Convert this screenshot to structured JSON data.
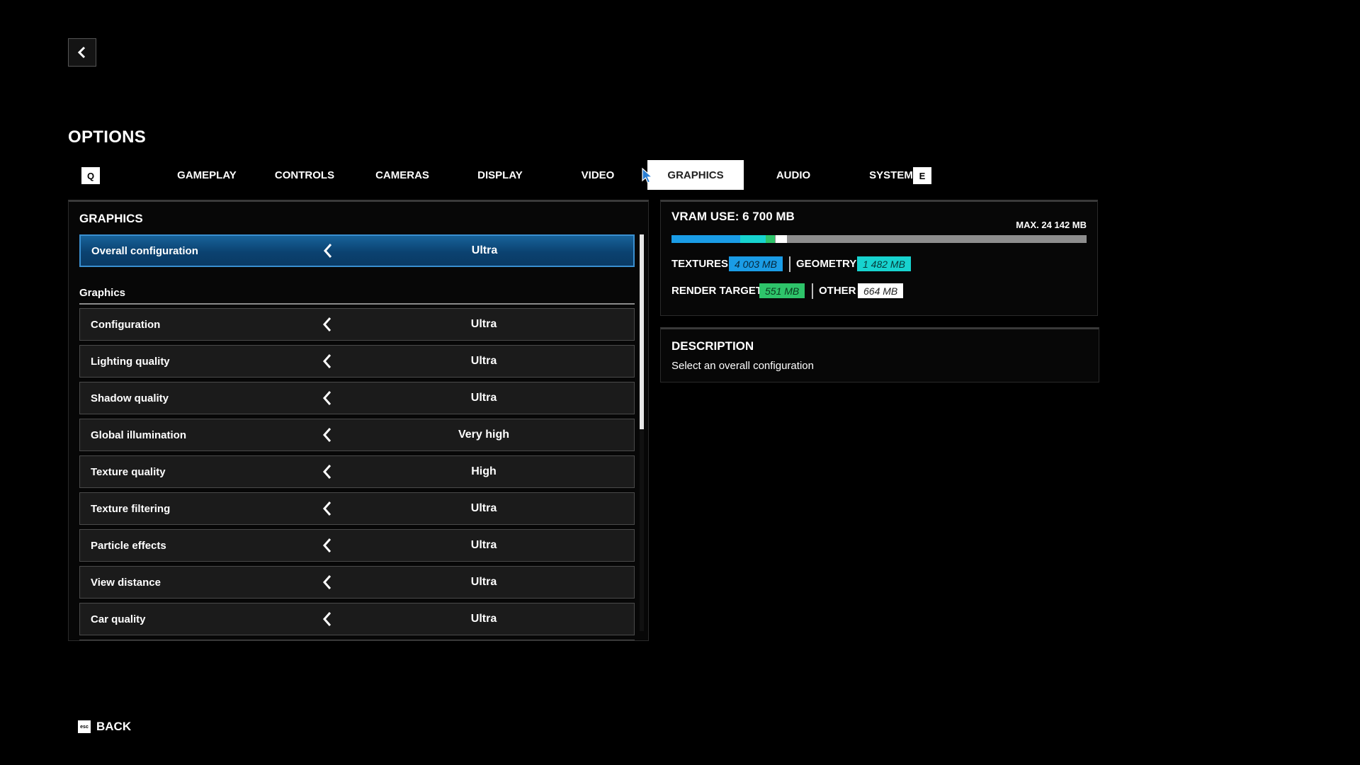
{
  "header": {
    "title": "OPTIONS"
  },
  "tabs": {
    "prev_key": "Q",
    "next_key": "E",
    "items": [
      {
        "label": "GAMEPLAY"
      },
      {
        "label": "CONTROLS"
      },
      {
        "label": "CAMERAS"
      },
      {
        "label": "DISPLAY"
      },
      {
        "label": "VIDEO"
      },
      {
        "label": "GRAPHICS",
        "active": true
      },
      {
        "label": "AUDIO"
      },
      {
        "label": "SYSTEM"
      }
    ]
  },
  "graphics_panel": {
    "title": "GRAPHICS",
    "overall": {
      "label": "Overall configuration",
      "value": "Ultra"
    },
    "section_label": "Graphics",
    "settings": [
      {
        "label": "Configuration",
        "value": "Ultra"
      },
      {
        "label": "Lighting quality",
        "value": "Ultra"
      },
      {
        "label": "Shadow quality",
        "value": "Ultra"
      },
      {
        "label": "Global illumination",
        "value": "Very high"
      },
      {
        "label": "Texture quality",
        "value": "High"
      },
      {
        "label": "Texture filtering",
        "value": "Ultra"
      },
      {
        "label": "Particle effects",
        "value": "Ultra"
      },
      {
        "label": "View distance",
        "value": "Ultra"
      },
      {
        "label": "Car quality",
        "value": "Ultra"
      }
    ]
  },
  "vram": {
    "title": "VRAM USE: 6 700 MB",
    "max_label": "MAX. 24 142 MB",
    "max_mb": 24142,
    "breakdown": [
      {
        "label": "TEXTURES",
        "value": "4 003 MB",
        "mb": 4003,
        "color": "#1a9ce6"
      },
      {
        "label": "GEOMETRY",
        "value": "1 482 MB",
        "mb": 1482,
        "color": "#17d3cf"
      },
      {
        "label": "RENDER TARGET",
        "value": "551 MB",
        "mb": 551,
        "color": "#2ec46a"
      },
      {
        "label": "OTHER",
        "value": "664 MB",
        "mb": 664,
        "color": "#ffffff"
      }
    ]
  },
  "description": {
    "title": "DESCRIPTION",
    "text": "Select an overall configuration"
  },
  "footer": {
    "esc_key": "esc",
    "back_label": "BACK"
  }
}
